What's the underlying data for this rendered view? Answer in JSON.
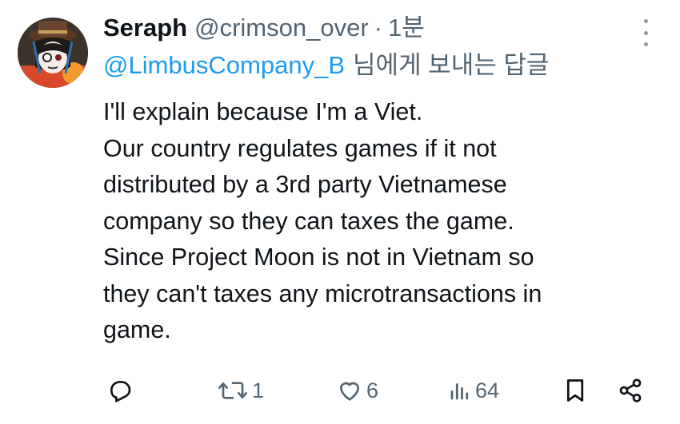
{
  "tweet": {
    "display_name": "Seraph",
    "handle": "@crimson_over",
    "separator": "·",
    "time": "1분",
    "reply_to": {
      "mention": "@LimbusCompany_B",
      "suffix": "님에게 보내는 답글"
    },
    "body_lines": [
      "I'll explain because I'm a Viet.",
      "Our country regulates games if it not",
      "distributed by a 3rd party Vietnamese",
      "company so they can taxes the game.",
      "Since Project Moon is not in Vietnam so",
      "they can't taxes any microtransactions in",
      "game."
    ]
  },
  "actions": {
    "reply": {
      "icon": "reply-icon",
      "count": ""
    },
    "retweet": {
      "icon": "retweet-icon",
      "count": "1"
    },
    "like": {
      "icon": "heart-icon",
      "count": "6"
    },
    "views": {
      "icon": "views-icon",
      "count": "64"
    },
    "bookmark": {
      "icon": "bookmark-icon"
    },
    "share": {
      "icon": "share-icon"
    }
  },
  "colors": {
    "text": "#0f1419",
    "secondary": "#536471",
    "link": "#1d9bf0"
  }
}
